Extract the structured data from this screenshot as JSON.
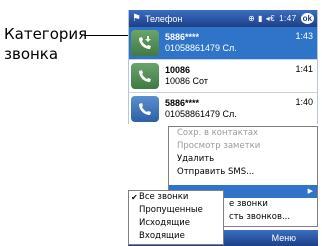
{
  "callout": {
    "label_line1": "Категория",
    "label_line2": "звонка"
  },
  "titlebar": {
    "title": "Телефон",
    "status": "1:47",
    "ok_label": "ok",
    "status_icons": "signal-battery-icons"
  },
  "calls": [
    {
      "name": "5886****",
      "detail": "01058861479 Сл.",
      "time": "1:43",
      "selected": true,
      "icon": "incoming-call-icon"
    },
    {
      "name": "10086",
      "detail": "10086 Сот",
      "time": "1:41",
      "selected": false,
      "icon": "incoming-call-icon"
    },
    {
      "name": "5886****",
      "detail": "01058861479 Сл.",
      "time": "1:40",
      "selected": false,
      "icon": "outgoing-call-icon"
    }
  ],
  "context_menu": {
    "items": [
      {
        "label": "Сохр. в контактах",
        "disabled": true
      },
      {
        "label": "Просмотр заметки",
        "disabled": true
      },
      {
        "label": "Удалить",
        "disabled": false
      },
      {
        "label": "Отправить SMS...",
        "disabled": false
      }
    ],
    "partial_items": [
      "е звонки",
      "сть звонков..."
    ]
  },
  "submenu": {
    "items": [
      {
        "label": "Все звонки",
        "checked": true
      },
      {
        "label": "Пропущенные",
        "checked": false
      },
      {
        "label": "Исходящие",
        "checked": false
      },
      {
        "label": "Входящие",
        "checked": false
      }
    ]
  },
  "softkeys": {
    "left": "П",
    "right": "Меню"
  }
}
